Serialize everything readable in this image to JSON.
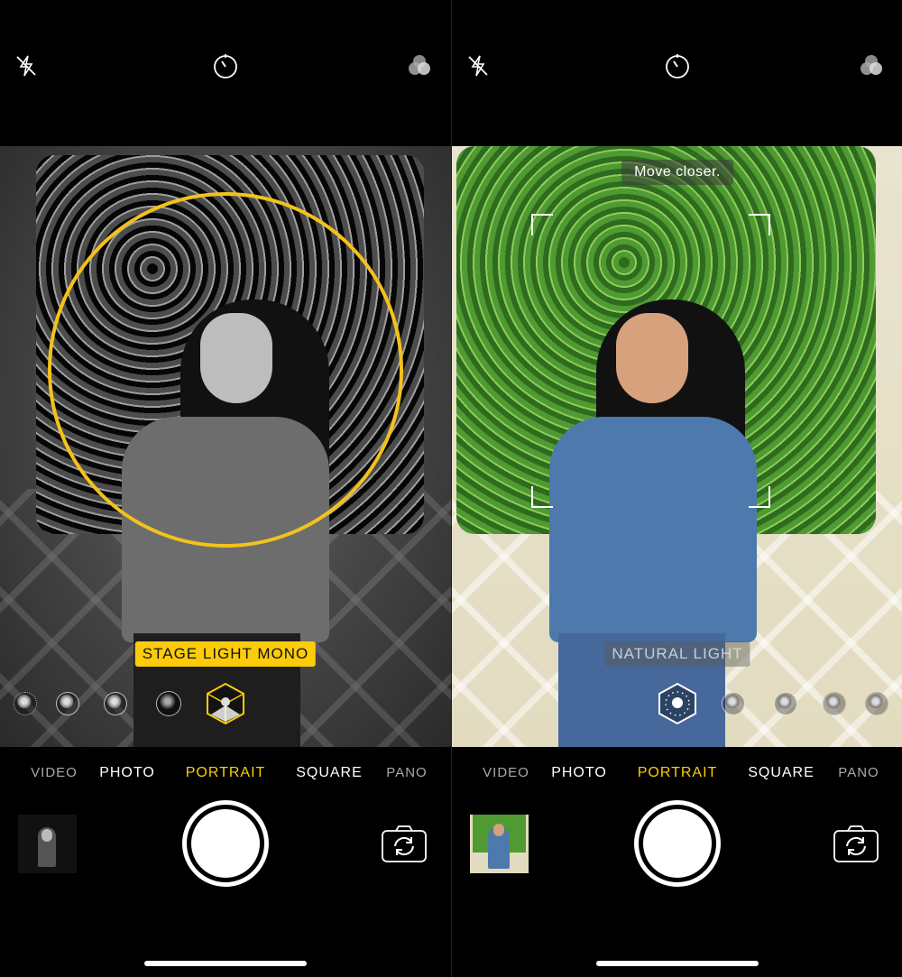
{
  "screens": [
    {
      "id": "left",
      "top_bar": {
        "icons": [
          "flash-off-icon",
          "timer-icon",
          "filters-icon"
        ]
      },
      "lighting": {
        "label": "STAGE LIGHT MONO",
        "selected": "stage-light-mono",
        "accent": "#fccc0a",
        "options": [
          "natural-light",
          "studio-light",
          "contour-light",
          "stage-light",
          "stage-light-mono"
        ]
      },
      "modes": [
        "VIDEO",
        "PHOTO",
        "PORTRAIT",
        "SQUARE",
        "PANO"
      ],
      "selected_mode": "PORTRAIT"
    },
    {
      "id": "right",
      "top_bar": {
        "icons": [
          "flash-off-icon",
          "timer-icon",
          "filters-icon"
        ]
      },
      "hint": "Move closer.",
      "lighting": {
        "label": "NATURAL LIGHT",
        "selected": "natural-light",
        "options": [
          "natural-light",
          "studio-light",
          "contour-light",
          "stage-light",
          "stage-light-mono"
        ]
      },
      "modes": [
        "VIDEO",
        "PHOTO",
        "PORTRAIT",
        "SQUARE",
        "PANO"
      ],
      "selected_mode": "PORTRAIT"
    }
  ],
  "colors": {
    "accent": "#fccc0a",
    "focus_ring": "#f3c21c"
  }
}
